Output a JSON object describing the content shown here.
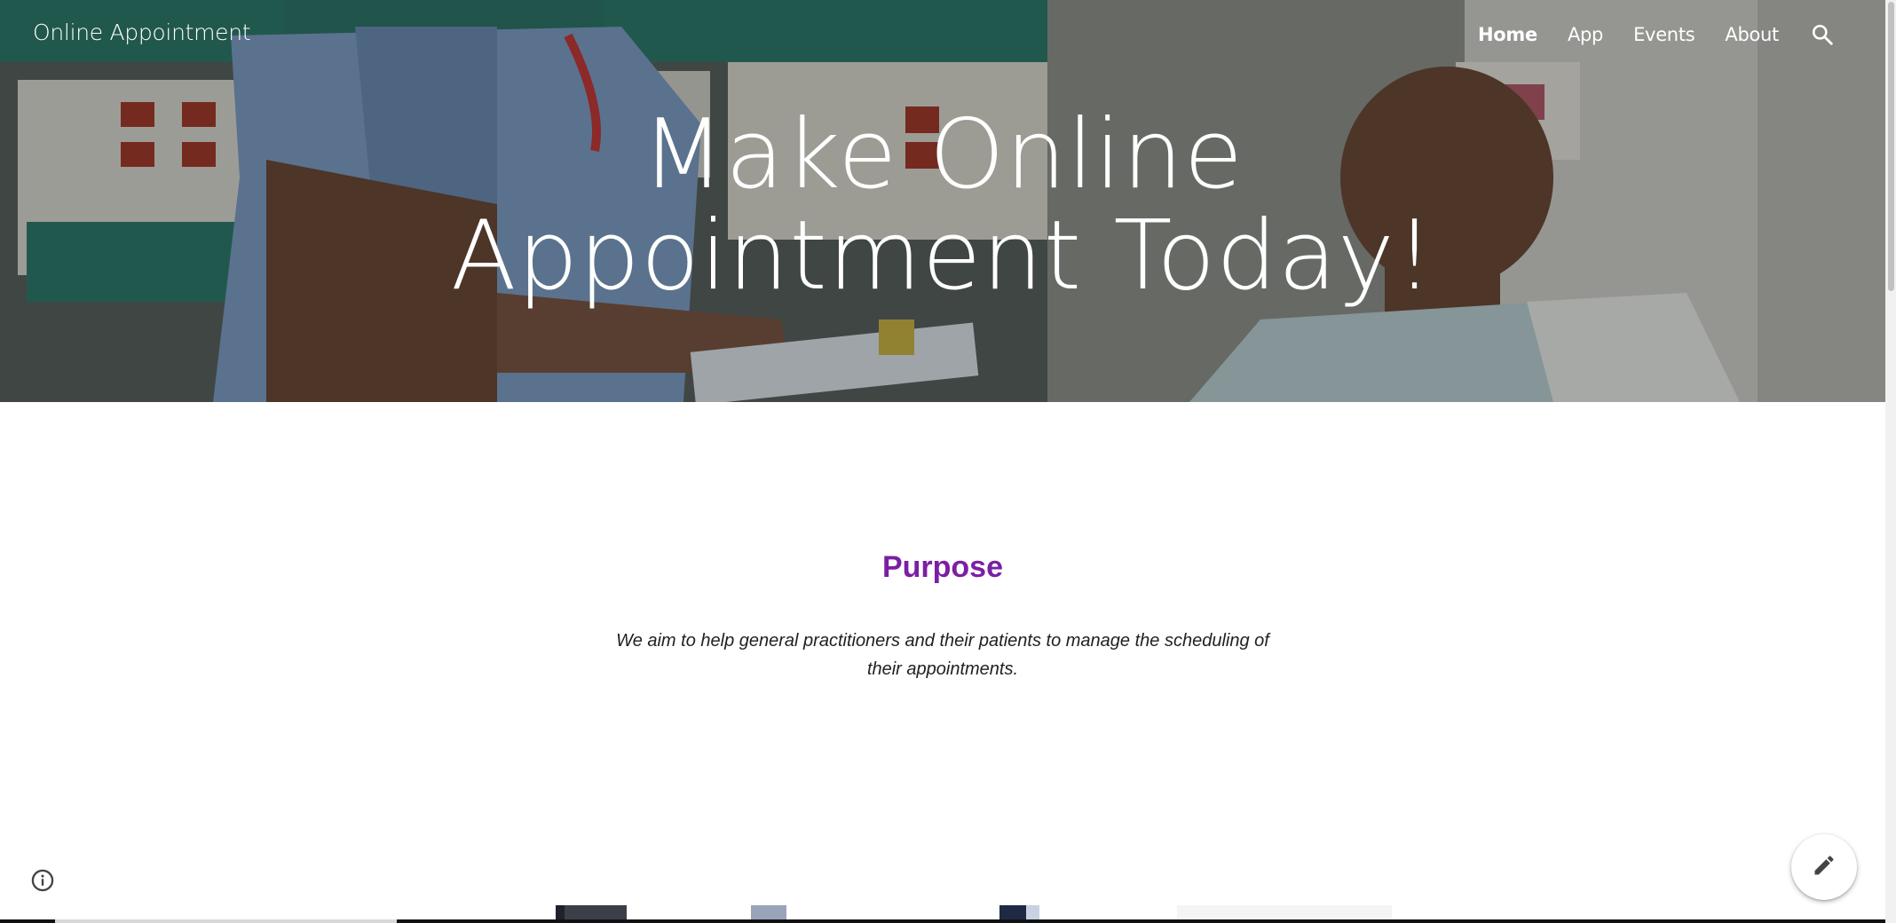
{
  "site": {
    "title": "Online Appointment"
  },
  "nav": {
    "items": [
      {
        "label": "Home",
        "active": true
      },
      {
        "label": "App",
        "active": false
      },
      {
        "label": "Events",
        "active": false
      },
      {
        "label": "About",
        "active": false
      }
    ],
    "search_icon": "search-icon"
  },
  "hero": {
    "line1": "Make Online",
    "line2": "Appointment Today!"
  },
  "purpose": {
    "title": "Purpose",
    "line1": "We aim to help general practitioners and their patients  to manage the scheduling of",
    "line2": "their appointments."
  },
  "icons": {
    "info": "info-icon",
    "edit": "pencil-icon"
  },
  "colors": {
    "accent": "#7b1fa2",
    "hero_text": "#ffffff",
    "body_text": "#212121"
  }
}
